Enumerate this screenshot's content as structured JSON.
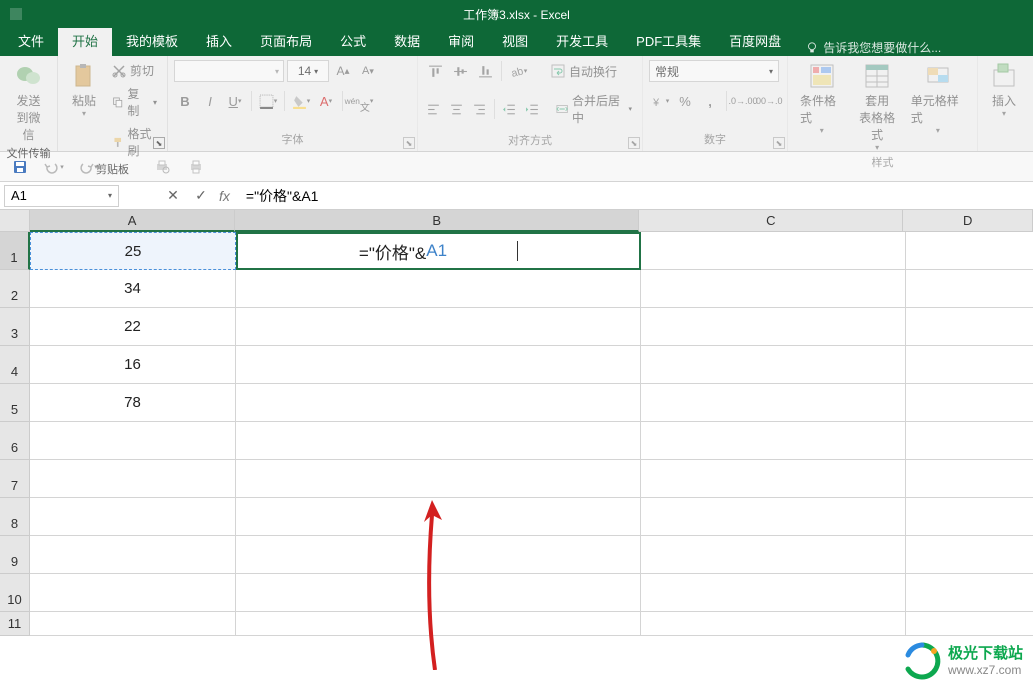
{
  "title": "工作簿3.xlsx - Excel",
  "tabs": [
    "文件",
    "开始",
    "我的模板",
    "插入",
    "页面布局",
    "公式",
    "数据",
    "审阅",
    "视图",
    "开发工具",
    "PDF工具集",
    "百度网盘"
  ],
  "active_tab": 1,
  "tell_me": "告诉我您想要做什么...",
  "groups": {
    "wechat": {
      "label": "文件传输",
      "btn": "发送\n到微信"
    },
    "clipboard": {
      "label": "剪贴板",
      "paste": "粘贴",
      "cut": "剪切",
      "copy": "复制",
      "painter": "格式刷"
    },
    "font": {
      "label": "字体",
      "font_name": "",
      "font_size": "14",
      "buttons": [
        "B",
        "I",
        "U"
      ]
    },
    "align": {
      "label": "对齐方式",
      "wrap": "自动换行",
      "merge": "合并后居中"
    },
    "number": {
      "label": "数字",
      "format": "常规"
    },
    "styles": {
      "label": "样式",
      "cond": "条件格式",
      "table": "套用\n表格格式",
      "cell": "单元格样式"
    },
    "insert": {
      "label": "",
      "btn": "插入"
    }
  },
  "name_box": "A1",
  "formula": "=\"价格\"&A1",
  "formula_parts": {
    "prefix": "=\"价格\"&",
    "ref": "A1"
  },
  "columns": [
    "A",
    "B",
    "C",
    "D"
  ],
  "rows": [
    {
      "n": "1",
      "a": "25",
      "b_formula": true
    },
    {
      "n": "2",
      "a": "34"
    },
    {
      "n": "3",
      "a": "22"
    },
    {
      "n": "4",
      "a": "16"
    },
    {
      "n": "5",
      "a": "78"
    },
    {
      "n": "6",
      "a": ""
    },
    {
      "n": "7",
      "a": ""
    },
    {
      "n": "8",
      "a": ""
    },
    {
      "n": "9",
      "a": ""
    },
    {
      "n": "10",
      "a": ""
    },
    {
      "n": "11",
      "a": ""
    }
  ],
  "watermark": {
    "name": "极光下载站",
    "url": "www.xz7.com"
  }
}
